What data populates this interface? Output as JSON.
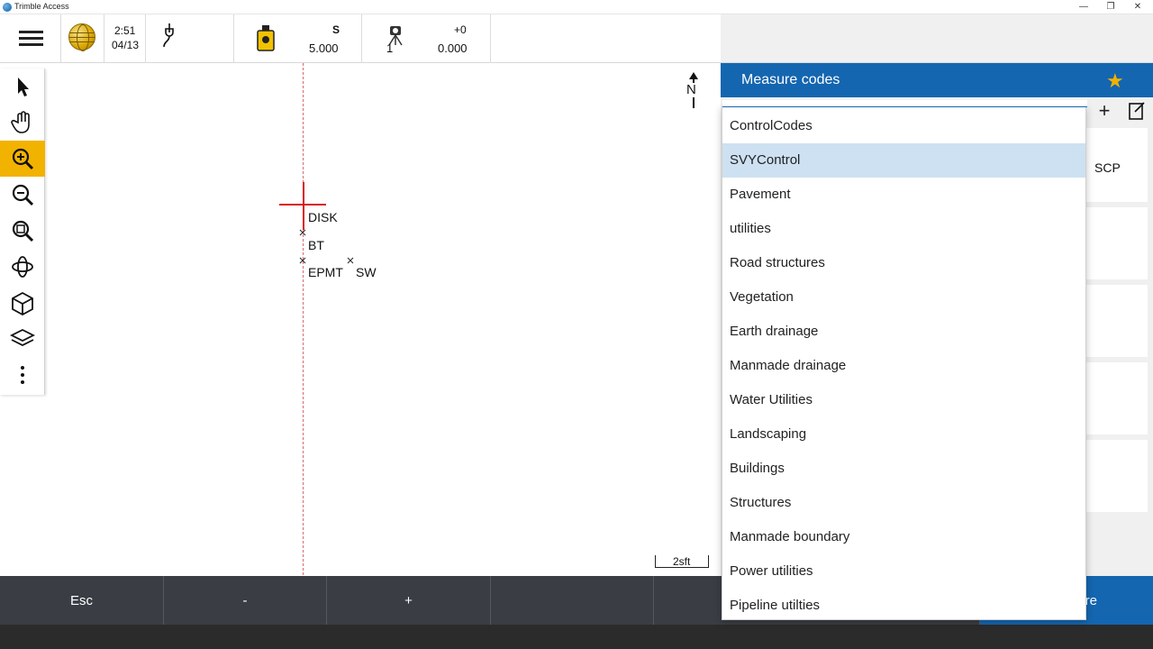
{
  "window": {
    "title": "Trimble Access",
    "minimize": "—",
    "restore": "❐",
    "close": "✕"
  },
  "status": {
    "time": "2:51",
    "date": "04/13",
    "target_label": "S",
    "target_value": "5.000",
    "instrument_face": "1",
    "offset_label": "+0",
    "offset_value": "0.000"
  },
  "tools": [
    {
      "name": "select-icon"
    },
    {
      "name": "pan-icon"
    },
    {
      "name": "zoom-in-icon",
      "active": true
    },
    {
      "name": "zoom-out-icon"
    },
    {
      "name": "zoom-extents-icon"
    },
    {
      "name": "orbit-icon"
    },
    {
      "name": "view-3d-icon"
    },
    {
      "name": "layers-icon"
    },
    {
      "name": "more-icon"
    }
  ],
  "map": {
    "labels": [
      "DISK",
      "BT",
      "EPMT",
      "SW"
    ],
    "north": "N",
    "scale": "2sft"
  },
  "softkeys": {
    "esc": "Esc",
    "minus": "-",
    "plus": "+",
    "measure_partial": "re"
  },
  "panel": {
    "title": "Measure codes",
    "add": "+",
    "card_label": "SCP"
  },
  "dropdown": {
    "selected_index": 1,
    "items": [
      "ControlCodes",
      "SVYControl",
      "Pavement",
      "utilities",
      "Road structures",
      "Vegetation",
      "Earth drainage",
      "Manmade drainage",
      "Water Utilities",
      "Landscaping",
      "Buildings",
      "Structures",
      "Manmade boundary",
      "Power utilities",
      "Pipeline utilties"
    ]
  },
  "colors": {
    "accent": "#1466b0",
    "active_tool": "#f2b200",
    "softkey_bg": "#3a3d44",
    "selected_row": "#cde1f2"
  }
}
